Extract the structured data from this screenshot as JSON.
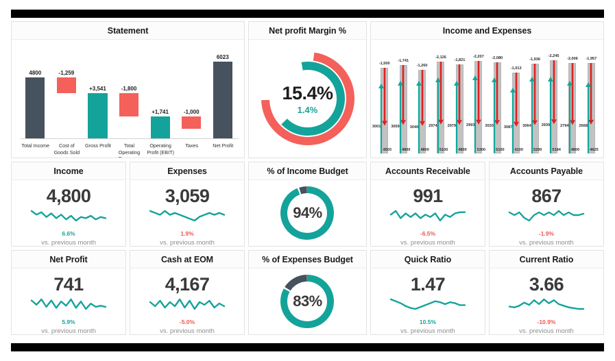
{
  "theme": {
    "teal": "#14a39a",
    "red": "#f4605a",
    "dark_slate": "#46525e",
    "grey_bar": "#c2c2c2",
    "arrow_red": "#e02020",
    "arrow_teal": "#11a79c",
    "text_dark": "#3a3a3a",
    "text_muted": "#8d8d8d",
    "black_bar": "#000000"
  },
  "cards": {
    "statement": {
      "title": "Statement"
    },
    "net_profit_margin": {
      "title": "Net profit Margin %"
    },
    "income_expenses": {
      "title": "Income and Expenses"
    },
    "income": {
      "title": "Income"
    },
    "expenses": {
      "title": "Expenses"
    },
    "pct_income_budget": {
      "title": "% of Income Budget"
    },
    "accounts_receivable": {
      "title": "Accounts Receivable"
    },
    "accounts_payable": {
      "title": "Accounts Payable"
    },
    "net_profit": {
      "title": "Net Profit"
    },
    "cash_eom": {
      "title": "Cash at EOM"
    },
    "pct_expenses_budget": {
      "title": "% of Expenses Budget"
    },
    "quick_ratio": {
      "title": "Quick Ratio"
    },
    "current_ratio": {
      "title": "Current Ratio"
    }
  },
  "chart_data": [
    {
      "id": "statement_waterfall",
      "type": "bar",
      "title": "Statement",
      "xlabel": "",
      "ylabel": "",
      "categories": [
        "Total Income",
        "Cost of Goods Sold",
        "Gross Profit",
        "Total Operating Expenses",
        "Operating Profit (EBIT)",
        "Taxes",
        "Net Profit"
      ],
      "labels": [
        "4800",
        "-1,259",
        "+3,541",
        "-1,800",
        "+1,741",
        "-1,000",
        "6023"
      ],
      "values": [
        4800,
        -1259,
        3541,
        -1800,
        1741,
        -1000,
        6023
      ],
      "bar_kinds": [
        "total",
        "decrease",
        "increase",
        "decrease",
        "increase",
        "decrease",
        "total"
      ],
      "bar_colors": [
        "#46525e",
        "#f4605a",
        "#14a39a",
        "#f4605a",
        "#14a39a",
        "#f4605a",
        "#46525e"
      ],
      "ylim": [
        0,
        6023
      ],
      "grid": false,
      "legend": "none"
    },
    {
      "id": "net_profit_margin_donut",
      "type": "pie",
      "title": "Net profit Margin %",
      "center_primary": "15.4%",
      "center_secondary": "1.4%",
      "rings": [
        {
          "name": "Outer",
          "color": "#f4605a",
          "value_pct": 84
        },
        {
          "name": "Inner",
          "color": "#14a39a",
          "value_pct": 78
        }
      ],
      "legend": "none"
    },
    {
      "id": "income_expenses_chart",
      "type": "bar",
      "title": "Income and Expenses",
      "xlabel": "",
      "ylabel": "",
      "series": [
        {
          "name": "Expenses",
          "color": "#e02020",
          "values": [
            -1500,
            -1741,
            -1260,
            -2126,
            -1821,
            -2207,
            -2080,
            -1013,
            -1936,
            -2245,
            -2006,
            -1957
          ],
          "labels": [
            "-1,500",
            "-1,741",
            "-1,260",
            "-2,126",
            "-1,821",
            "-2,207",
            "-2,080",
            "-1,013",
            "-1,936",
            "-2,245",
            "-2,006",
            "-1,957"
          ]
        },
        {
          "name": "Balance",
          "color": "#c2c2c2",
          "values": [
            3001,
            3059,
            3040,
            2974,
            2979,
            2993,
            3020,
            3087,
            3064,
            2939,
            2794,
            2668
          ],
          "labels": [
            "3001",
            "3059",
            "3040",
            "2974",
            "2979",
            "2993",
            "3020",
            "3087",
            "3064",
            "2939",
            "2794",
            "2668"
          ]
        },
        {
          "name": "Income",
          "color": "#11a79c",
          "values": [
            4503,
            4800,
            4800,
            5100,
            4800,
            5300,
            5100,
            4100,
            5200,
            5184,
            4800,
            4625
          ],
          "labels": [
            "4503",
            "4800",
            "4800",
            "5100",
            "4800",
            "5300",
            "5100",
            "4100",
            "5200",
            "5184",
            "4800",
            "4625"
          ]
        }
      ],
      "grid": false,
      "legend": "none"
    },
    {
      "id": "pct_income_budget_donut",
      "type": "pie",
      "title": "% of Income Budget",
      "center_label": "94%",
      "slices": [
        {
          "name": "Achieved",
          "value": 94,
          "color": "#14a39a"
        },
        {
          "name": "Remaining",
          "value": 6,
          "color": "#46525e"
        }
      ],
      "legend": "none"
    },
    {
      "id": "pct_expenses_budget_donut",
      "type": "pie",
      "title": "% of Expenses Budget",
      "center_label": "83%",
      "slices": [
        {
          "name": "Achieved",
          "value": 83,
          "color": "#14a39a"
        },
        {
          "name": "Remaining",
          "value": 17,
          "color": "#46525e"
        }
      ],
      "legend": "none"
    }
  ],
  "kpis": [
    {
      "id": "income",
      "title": "Income",
      "value": "4,800",
      "delta": "6.6%",
      "delta_direction": "up",
      "note": "vs. previous month",
      "sparkline": [
        32,
        26,
        30,
        22,
        28,
        20,
        26,
        18,
        24,
        16,
        22,
        20,
        24,
        18,
        22,
        20
      ]
    },
    {
      "id": "expenses",
      "title": "Expenses",
      "value": "3,059",
      "delta": "1.9%",
      "delta_direction": "down",
      "note": "vs. previous month",
      "sparkline": [
        22,
        21,
        20,
        22,
        20,
        21,
        20,
        19,
        18,
        17,
        19,
        20,
        21,
        20,
        21,
        20
      ]
    },
    {
      "id": "accounts_receivable",
      "title": "Accounts Receivable",
      "value": "991",
      "delta": "-6.5%",
      "delta_direction": "down",
      "note": "vs. previous month",
      "sparkline": [
        24,
        30,
        18,
        26,
        20,
        26,
        18,
        24,
        20,
        26,
        14,
        24,
        20,
        26,
        28,
        28
      ]
    },
    {
      "id": "accounts_payable",
      "title": "Accounts Payable",
      "value": "867",
      "delta": "-1.9%",
      "delta_direction": "down",
      "note": "vs. previous month",
      "sparkline": [
        22,
        20,
        22,
        18,
        16,
        20,
        22,
        20,
        22,
        20,
        23,
        20,
        22,
        20,
        20,
        21
      ]
    },
    {
      "id": "net_profit",
      "title": "Net Profit",
      "value": "741",
      "delta": "5.9%",
      "delta_direction": "up",
      "note": "vs. previous month",
      "sparkline": [
        28,
        20,
        30,
        16,
        28,
        14,
        26,
        18,
        30,
        14,
        26,
        12,
        22,
        16,
        18,
        16
      ]
    },
    {
      "id": "cash_eom",
      "title": "Cash at EOM",
      "value": "4,167",
      "delta": "-5.0%",
      "delta_direction": "down",
      "note": "vs. previous month",
      "sparkline": [
        24,
        18,
        26,
        16,
        24,
        18,
        28,
        16,
        26,
        14,
        24,
        20,
        26,
        16,
        22,
        18
      ]
    },
    {
      "id": "quick_ratio",
      "title": "Quick Ratio",
      "value": "1.47",
      "delta": "10.5%",
      "delta_direction": "up",
      "note": "vs. previous month",
      "sparkline": [
        24,
        22,
        20,
        17,
        15,
        14,
        16,
        18,
        20,
        22,
        21,
        19,
        21,
        20,
        18,
        18
      ]
    },
    {
      "id": "current_ratio",
      "title": "Current Ratio",
      "value": "3.66",
      "delta": "-10.9%",
      "delta_direction": "down",
      "note": "vs. previous month",
      "sparkline": [
        18,
        17,
        19,
        23,
        20,
        26,
        21,
        27,
        22,
        26,
        21,
        19,
        17,
        16,
        15,
        15
      ]
    }
  ]
}
